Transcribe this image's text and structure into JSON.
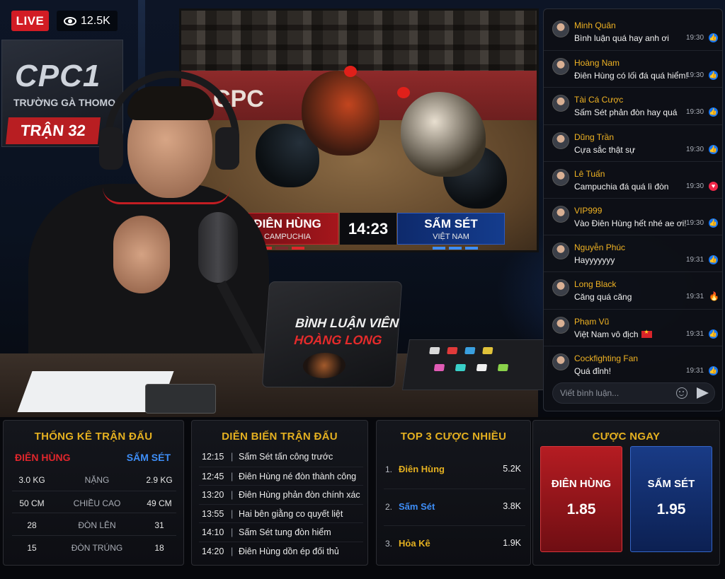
{
  "stream": {
    "live_label": "LIVE",
    "viewer_count": "12.5K",
    "brand": "CPC1",
    "brand_subtitle": "TRƯỜNG GÀ THOMO",
    "round_label": "TRẬN 32"
  },
  "arena": {
    "wall_logo": "CPC",
    "scoreboard": {
      "left_name": "ĐIÊN HÙNG",
      "left_country": "CAMPUCHIA",
      "time": "14:23",
      "right_name": "SẤM SÉT",
      "right_country": "VIỆT NAM"
    }
  },
  "laptop": {
    "line1": "BÌNH LUẬN VIÊN",
    "line2": "HOÀNG LONG"
  },
  "chat": {
    "messages": [
      {
        "name": "Minh Quân",
        "text": "Bình luận quá hay anh ơi",
        "time": "19:30",
        "reaction": "like"
      },
      {
        "name": "Hoàng Nam",
        "text": "Điên Hùng có lối đá quá hiểm!",
        "time": "19:30",
        "reaction": "like"
      },
      {
        "name": "Tài Cá Cược",
        "text": "Sấm Sét phản đòn hay quá",
        "time": "19:30",
        "reaction": "like"
      },
      {
        "name": "Dũng Trần",
        "text": "Cựa sắc thật sự",
        "time": "19:30",
        "reaction": "like"
      },
      {
        "name": "Lê Tuấn",
        "text": "Campuchia đá quá lì đòn",
        "time": "19:30",
        "reaction": "heart"
      },
      {
        "name": "VIP999",
        "text": "Vào Điên Hùng hết nhé ae ơi!",
        "time": "19:30",
        "reaction": "like"
      },
      {
        "name": "Nguyễn Phúc",
        "text": "Hayyyyyyy",
        "time": "19:31",
        "reaction": "like"
      },
      {
        "name": "Long Black",
        "text": "Căng quá căng",
        "time": "19:31",
        "reaction": "fire"
      },
      {
        "name": "Phạm Vũ",
        "text": "Việt Nam vô địch",
        "time": "19:31",
        "reaction": "like"
      },
      {
        "name": "Cockfighting Fan",
        "text": "Quá đỉnh!",
        "time": "19:31",
        "reaction": "like"
      }
    ],
    "input_placeholder": "Viết bình luận..."
  },
  "stats_panel": {
    "title": "THỐNG KÊ TRẬN ĐẤU",
    "left_team": "ĐIÊN HÙNG",
    "right_team": "SẤM SÉT",
    "rows": [
      {
        "left": "3.0 KG",
        "label": "NẶNG",
        "right": "2.9 KG"
      },
      {
        "left": "50 CM",
        "label": "CHIỀU CAO",
        "right": "49 CM"
      },
      {
        "left": "28",
        "label": "ĐÒN LÊN",
        "right": "31"
      },
      {
        "left": "15",
        "label": "ĐÒN TRÚNG",
        "right": "18"
      }
    ]
  },
  "events_panel": {
    "title": "DIỄN BIẾN TRẬN ĐẤU",
    "rows": [
      {
        "time": "12:15",
        "text": "Sấm Sét tấn công trước"
      },
      {
        "time": "12:45",
        "text": "Điên Hùng né đòn thành công"
      },
      {
        "time": "13:20",
        "text": "Điên Hùng phản đòn chính xác"
      },
      {
        "time": "13:55",
        "text": "Hai bên giằng co quyết liệt"
      },
      {
        "time": "14:10",
        "text": "Sấm Sét tung đòn hiểm"
      },
      {
        "time": "14:20",
        "text": "Điên Hùng dồn ép đối thủ"
      }
    ]
  },
  "top3_panel": {
    "title": "TOP 3 CƯỢC NHIỀU",
    "rows": [
      {
        "rank": "1.",
        "name": "Điên Hùng",
        "value": "5.2K",
        "color": "#e4b020"
      },
      {
        "rank": "2.",
        "name": "Sấm Sét",
        "value": "3.8K",
        "color": "#3e8ef7"
      },
      {
        "rank": "3.",
        "name": "Hỏa Kê",
        "value": "1.9K",
        "color": "#e4b020"
      }
    ]
  },
  "bet_panel": {
    "title": "CƯỢC NGAY",
    "options": [
      {
        "name": "ĐIÊN HÙNG",
        "odds": "1.85"
      },
      {
        "name": "SẤM SÉT",
        "odds": "1.95"
      }
    ]
  },
  "colors": {
    "accent_gold": "#e4b020",
    "red_team": "#e0262c",
    "blue_team": "#3e8ef7",
    "live_red": "#d21c24"
  }
}
